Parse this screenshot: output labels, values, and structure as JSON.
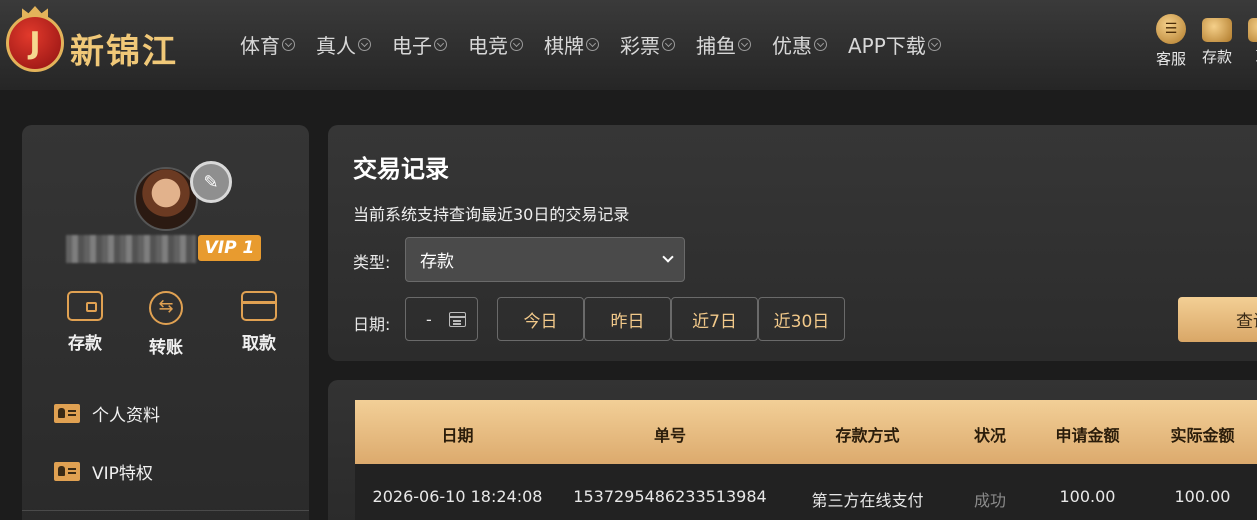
{
  "brand": {
    "logo_letter": "J",
    "name": "新锦江"
  },
  "nav": [
    {
      "label": "体育"
    },
    {
      "label": "真人"
    },
    {
      "label": "电子"
    },
    {
      "label": "电竞"
    },
    {
      "label": "棋牌"
    },
    {
      "label": "彩票"
    },
    {
      "label": "捕鱼"
    },
    {
      "label": "优惠"
    },
    {
      "label": "APP下载"
    }
  ],
  "header_actions": [
    {
      "label": "客服",
      "icon": "chat-icon"
    },
    {
      "label": "存款",
      "icon": "wallet-icon"
    },
    {
      "label": "取",
      "icon": "withdraw-icon"
    }
  ],
  "sidebar": {
    "vip_label": "VIP 1",
    "quick_actions": [
      {
        "label": "存款",
        "icon": "wallet-icon"
      },
      {
        "label": "转账",
        "icon": "transfer-icon"
      },
      {
        "label": "取款",
        "icon": "card-icon"
      }
    ],
    "menu": [
      {
        "label": "个人资料",
        "icon": "profile-card-icon"
      },
      {
        "label": "VIP特权",
        "icon": "vip-card-icon"
      }
    ]
  },
  "filter": {
    "title": "交易记录",
    "subtitle": "当前系统支持查询最近30日的交易记录",
    "type_label": "类型:",
    "type_value": "存款",
    "date_label": "日期:",
    "date_value": "-",
    "ranges": [
      "今日",
      "昨日",
      "近7日",
      "近30日"
    ],
    "query_label": "查询"
  },
  "table": {
    "columns": [
      "日期",
      "单号",
      "存款方式",
      "状况",
      "申请金额",
      "实际金额"
    ],
    "rows": [
      [
        "2026-06-10 18:24:08",
        "1537295486233513984",
        "第三方在线支付",
        "成功",
        "100.00",
        "100.00"
      ]
    ]
  },
  "colors": {
    "accent_gold": "#e0a152",
    "vip_orange": "#e89b2f",
    "header_gradient_top": "#f2cf97"
  }
}
